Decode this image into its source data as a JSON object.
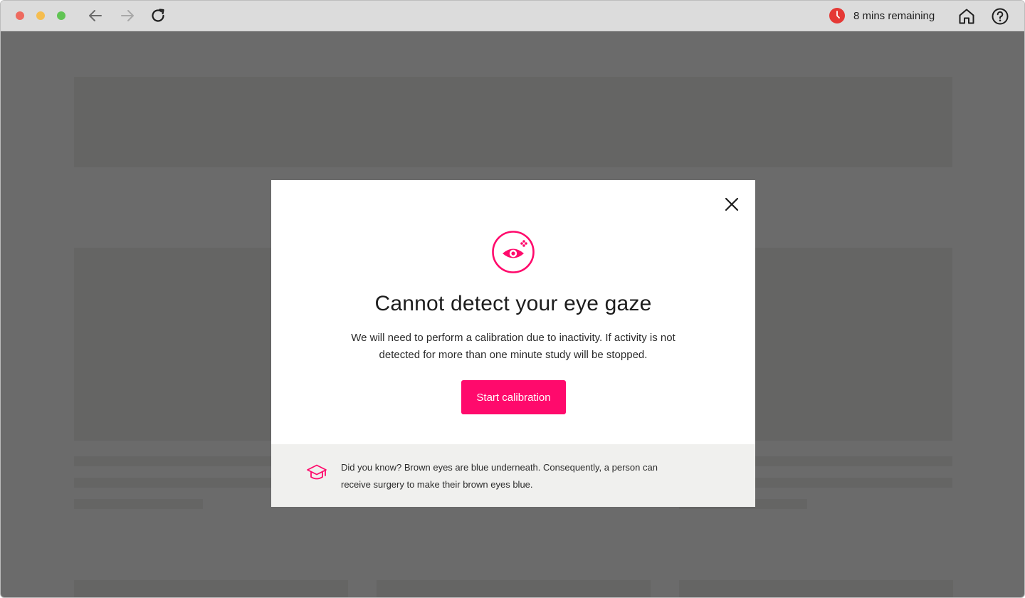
{
  "browser": {
    "timer_text": "8 mins remaining"
  },
  "modal": {
    "title": "Cannot detect your eye gaze",
    "body": "We will need to perform a calibration due to inactivity. If activity is not detected for more than one minute study will be stopped.",
    "primary_button": "Start calibration",
    "tip": "Did you know? Brown eyes are blue underneath. Consequently, a person can receive surgery to make their brown eyes blue."
  },
  "colors": {
    "accent": "#ff0a6c",
    "timer_icon": "#e53935",
    "overlay": "rgba(0,0,0,0.58)",
    "tip_background": "#f0f0ee"
  },
  "icons": {
    "back": "arrow-left-icon",
    "forward": "arrow-right-icon",
    "reload": "reload-icon",
    "timer": "clock-icon",
    "home": "home-icon",
    "help": "help-icon",
    "close": "close-icon",
    "hero": "eye-icon",
    "tip": "graduation-cap-icon"
  }
}
